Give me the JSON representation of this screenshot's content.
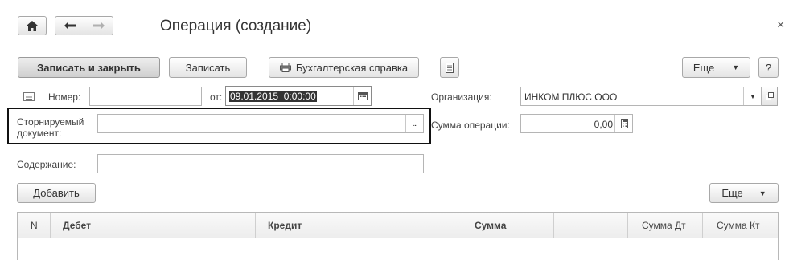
{
  "window": {
    "title": "Операция (создание)",
    "close_glyph": "×"
  },
  "toolbar": {
    "save_close_label": "Записать и закрыть",
    "save_label": "Записать",
    "accounting_ref_label": "Бухгалтерская справка",
    "more_label": "Еще",
    "help_label": "?"
  },
  "form": {
    "number_label": "Номер:",
    "number_value": "",
    "date_from_label": "от:",
    "date_value": "09.01.2015  0:00:00",
    "org_label": "Организация:",
    "org_value": "ИНКОМ ПЛЮС ООО",
    "reversed_doc_label": "Сторнируемый документ:",
    "reversed_doc_value": "",
    "amount_label": "Сумма операции:",
    "amount_value": "0,00",
    "content_label": "Содержание:",
    "content_value": ""
  },
  "table_toolbar": {
    "add_label": "Добавить",
    "more_label": "Еще"
  },
  "table": {
    "columns": [
      "N",
      "Дебет",
      "Кредит",
      "Сумма",
      "",
      "Сумма Дт",
      "Сумма Кт"
    ],
    "rows": []
  }
}
